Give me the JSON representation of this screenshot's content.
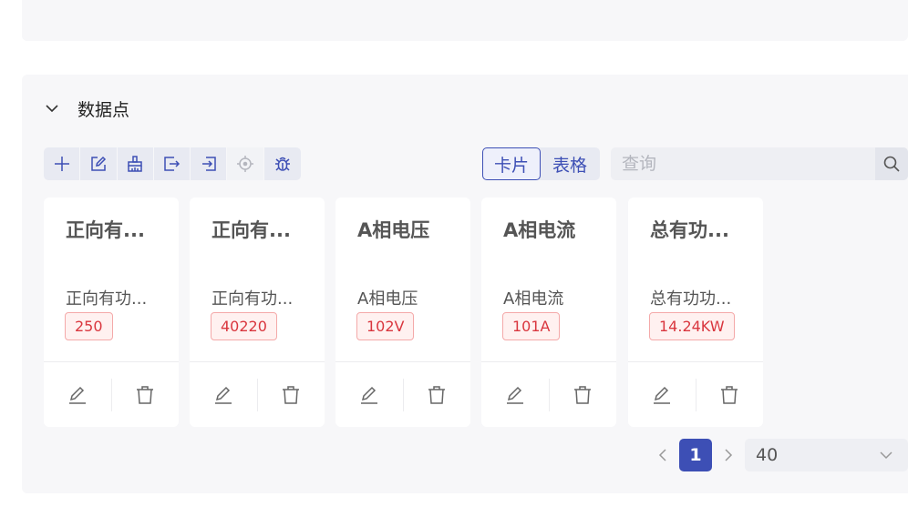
{
  "section": {
    "title": "数据点"
  },
  "toolbar": {
    "tools": [
      {
        "icon": "plus-icon"
      },
      {
        "icon": "edit-icon"
      },
      {
        "icon": "broom-icon"
      },
      {
        "icon": "export-icon"
      },
      {
        "icon": "import-icon"
      },
      {
        "icon": "locate-icon",
        "disabled": true
      },
      {
        "icon": "debug-icon"
      }
    ]
  },
  "view_toggle": {
    "card_label": "卡片",
    "table_label": "表格",
    "active": "card"
  },
  "search": {
    "placeholder": "查询",
    "value": ""
  },
  "cards": [
    {
      "title": "正向有...",
      "description": "正向有功...",
      "value": "250"
    },
    {
      "title": "正向有...",
      "description": "正向有功...",
      "value": "40220"
    },
    {
      "title": "A相电压",
      "description": "A相电压",
      "value": "102V"
    },
    {
      "title": "A相电流",
      "description": "A相电流",
      "value": "101A"
    },
    {
      "title": "总有功...",
      "description": "总有功功...",
      "value": "14.24KW"
    }
  ],
  "pagination": {
    "current_page": "1",
    "page_size": "40"
  },
  "colors": {
    "accent": "#3d4fb5",
    "value_text": "#d9363e",
    "value_bg": "#fff1f0",
    "value_border": "#f4a9a9"
  }
}
